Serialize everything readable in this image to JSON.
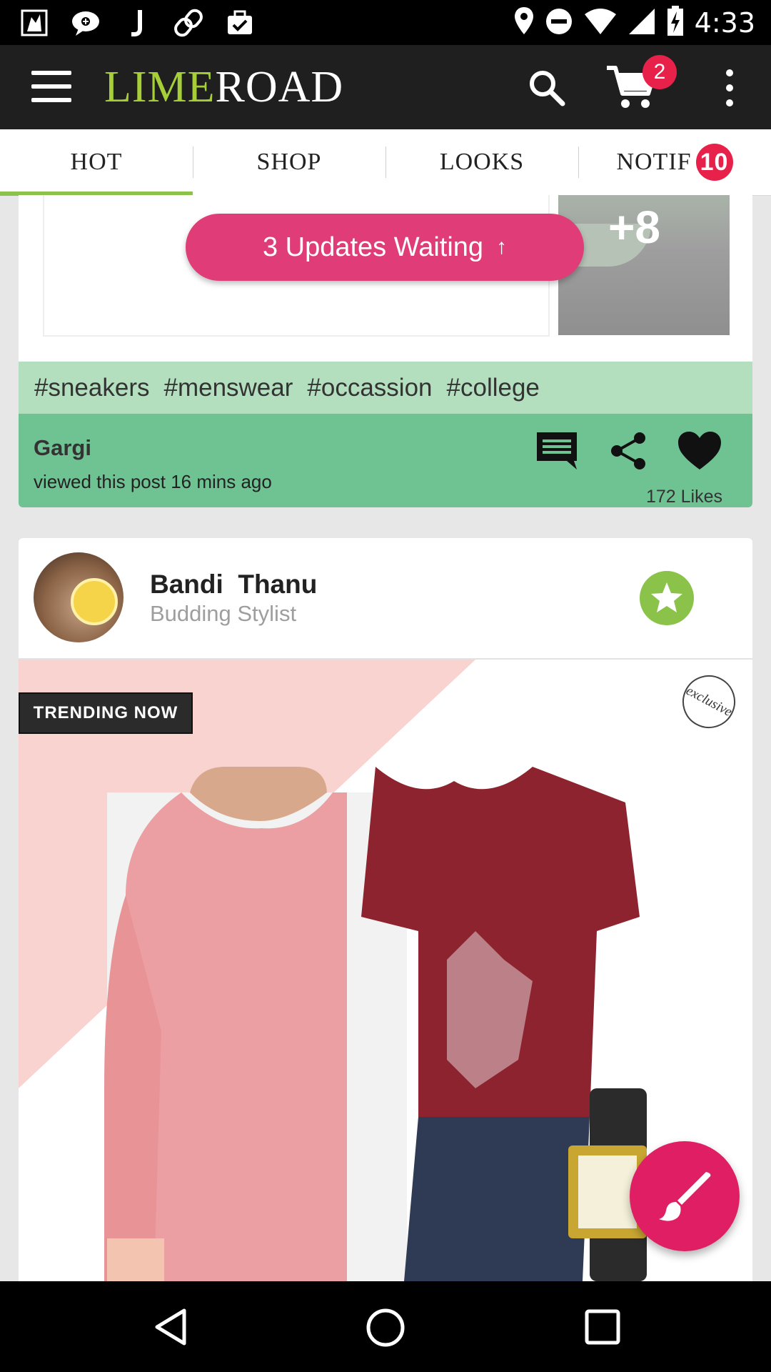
{
  "status_bar": {
    "time": "4:33",
    "left_icons": [
      "screenshot-icon",
      "chat-icon",
      "j-app-icon",
      "link-icon",
      "briefcase-check-icon"
    ],
    "right_icons": [
      "location-icon",
      "do-not-disturb-icon",
      "wifi-icon",
      "signal-icon",
      "battery-charging-icon"
    ]
  },
  "app_bar": {
    "logo_part1": "LIME",
    "logo_part2": "ROAD",
    "cart_count": "2",
    "colors": {
      "bar": "#1f1f1f",
      "logo_lime": "#a6ce39",
      "badge": "#e8214b"
    }
  },
  "tabs": [
    {
      "label": "HOT",
      "active": true
    },
    {
      "label": "SHOP",
      "active": false
    },
    {
      "label": "LOOKS",
      "active": false
    },
    {
      "label": "NOTIF",
      "active": false,
      "badge": "10"
    }
  ],
  "updates": {
    "label": "3 Updates Waiting",
    "arrow": "↑"
  },
  "post1": {
    "more_count": "+8",
    "hashtags": [
      "#sneakers",
      "#menswear",
      "#occassion",
      "#college"
    ],
    "viewer_name": "Gargi",
    "viewer_activity": "viewed this post 16 mins ago",
    "likes": "172 Likes",
    "colors": {
      "tags_bg": "#b3dfbf",
      "activity_bg": "#6fc393"
    }
  },
  "post2": {
    "author_name": "Bandi  Thanu",
    "author_role": "Budding Stylist",
    "trending_label": "TRENDING NOW",
    "exclusive_label": "exclusive"
  },
  "fab": {
    "icon": "brush-icon",
    "color": "#e01e63"
  }
}
